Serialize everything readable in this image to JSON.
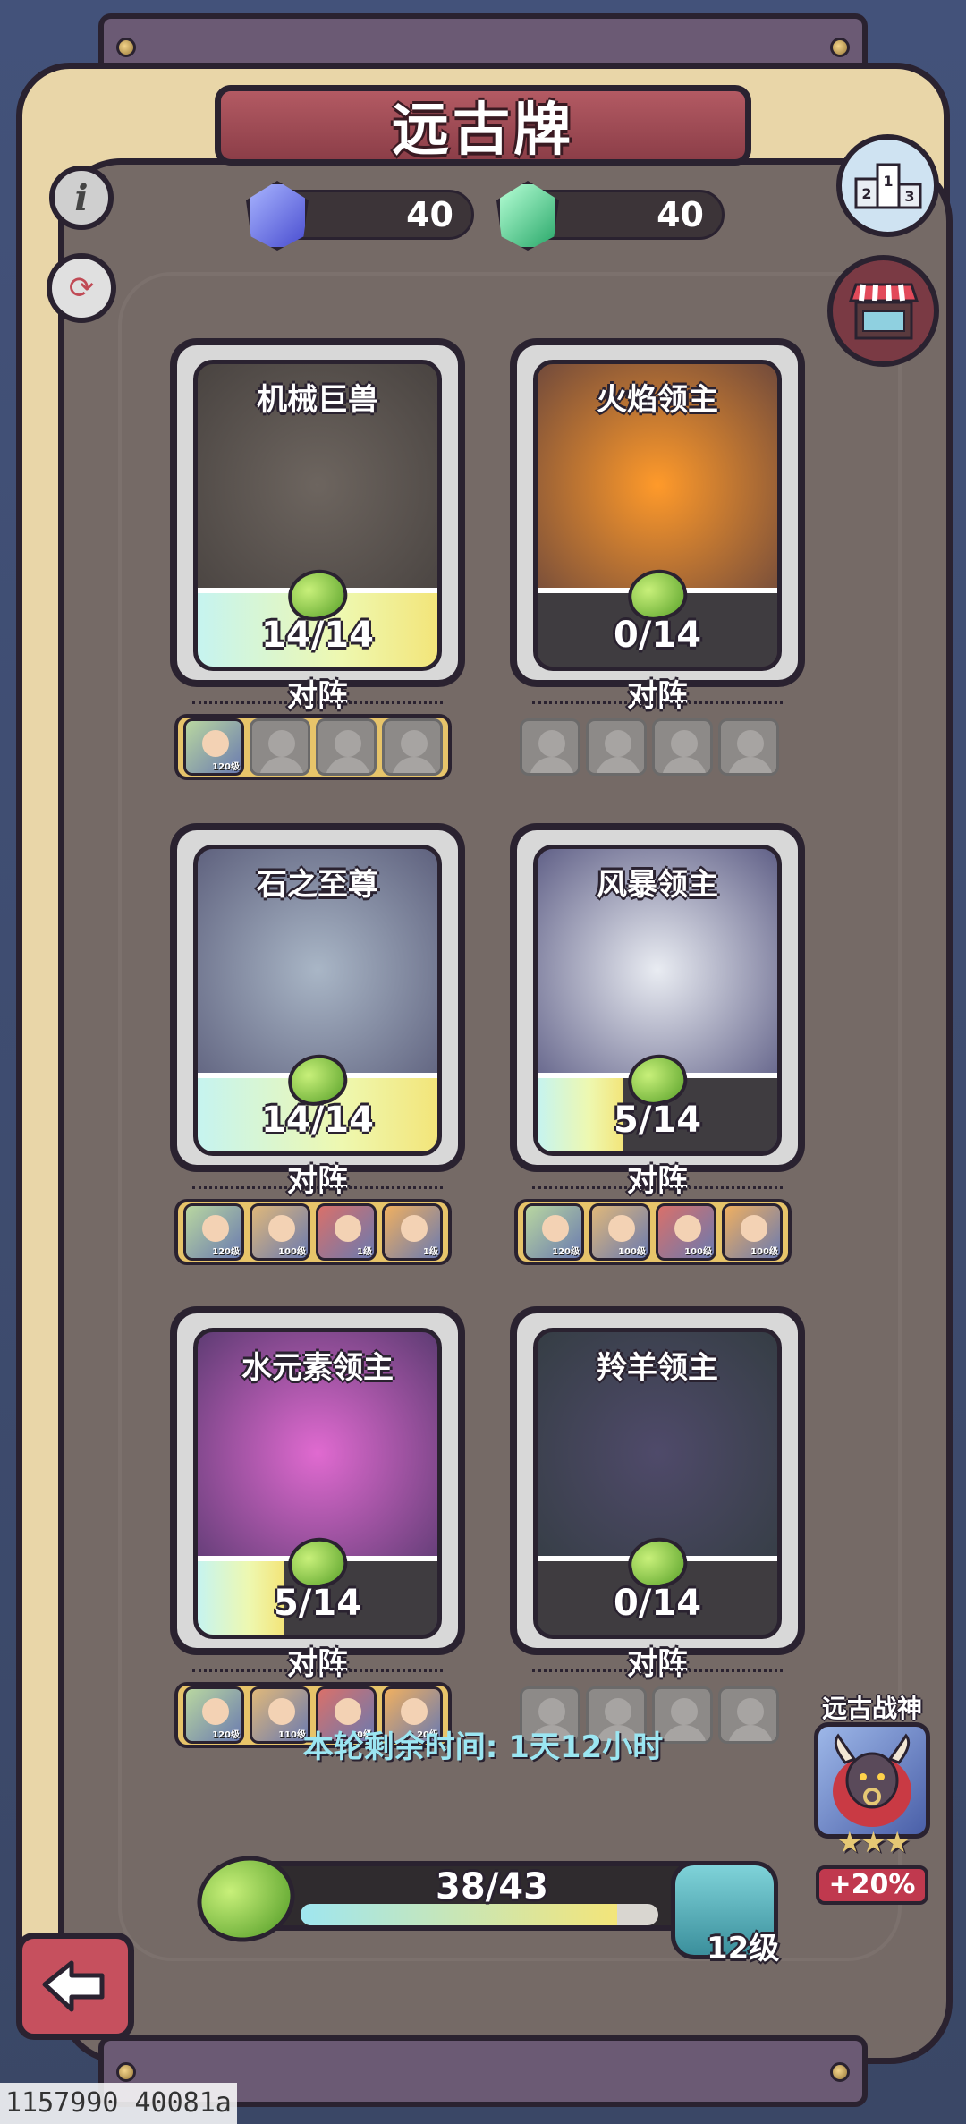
{
  "header": {
    "title": "远古牌"
  },
  "currencies": [
    {
      "name": "blue-gem",
      "value": "40",
      "color": "#4a4ed0"
    },
    {
      "name": "green-gem",
      "value": "40",
      "color": "#2aa86a"
    }
  ],
  "cards": [
    {
      "name": "机械巨兽",
      "count": "14/14",
      "progress": 1.0,
      "team_label": "对阵",
      "team_active": true,
      "team": [
        {
          "level": "120级"
        },
        null,
        null,
        null
      ],
      "art": [
        "#6d655f",
        "#3f3a38"
      ]
    },
    {
      "name": "火焰领主",
      "count": "0/14",
      "progress": 0.0,
      "team_label": "对阵",
      "team_active": false,
      "team": [
        null,
        null,
        null,
        null
      ],
      "art": [
        "#ff9a2a",
        "#4a3440"
      ]
    },
    {
      "name": "石之至尊",
      "count": "14/14",
      "progress": 1.0,
      "team_label": "对阵",
      "team_active": true,
      "team": [
        {
          "level": "120级"
        },
        {
          "level": "100级"
        },
        {
          "level": "1级"
        },
        {
          "level": "1级"
        }
      ],
      "art": [
        "#a9b6c6",
        "#4a4a6a"
      ]
    },
    {
      "name": "风暴领主",
      "count": "5/14",
      "progress": 0.36,
      "team_label": "对阵",
      "team_active": true,
      "team": [
        {
          "level": "120级"
        },
        {
          "level": "100级"
        },
        {
          "level": "100级"
        },
        {
          "level": "100级"
        }
      ],
      "art": [
        "#e9ecf2",
        "#3b3a6a"
      ]
    },
    {
      "name": "水元素领主",
      "count": "5/14",
      "progress": 0.36,
      "team_label": "对阵",
      "team_active": true,
      "team": [
        {
          "level": "120级"
        },
        {
          "level": "110级"
        },
        {
          "level": "40级"
        },
        {
          "level": "20级"
        }
      ],
      "art": [
        "#e06ad0",
        "#3a2f5a"
      ]
    },
    {
      "name": "羚羊领主",
      "count": "0/14",
      "progress": 0.0,
      "team_label": "对阵",
      "team_active": false,
      "team": [
        null,
        null,
        null,
        null
      ],
      "art": [
        "#4f4a6a",
        "#2e3a3a"
      ]
    }
  ],
  "footer": {
    "timer_text": "本轮剩余时间: 1天12小时",
    "progress_text": "38/43",
    "progress": 0.884,
    "level_text": "12级"
  },
  "ancient_god": {
    "title": "远古战神",
    "stars": "★★★",
    "bonus": "+20%"
  },
  "watermark": "1157990 40081a",
  "icons": {
    "info": "info-icon",
    "timer": "timer-icon",
    "rank": "leaderboard-icon",
    "shop": "shop-icon",
    "back": "back-arrow-icon"
  }
}
